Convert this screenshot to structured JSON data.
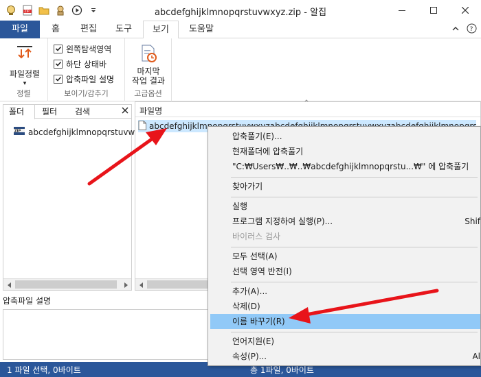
{
  "window": {
    "title": "abcdefghijklmnopqrstuvwxyz.zip - 알집"
  },
  "tabs": [
    {
      "label": "파일"
    },
    {
      "label": "홈"
    },
    {
      "label": "편집"
    },
    {
      "label": "도구"
    },
    {
      "label": "보기"
    },
    {
      "label": "도움말"
    }
  ],
  "ribbon": {
    "sort_label": "파일정렬",
    "sort_group": "정렬",
    "checks": [
      {
        "label": "왼쪽탐색영역",
        "checked": true
      },
      {
        "label": "하단 상태바",
        "checked": true
      },
      {
        "label": "압축파일 설명",
        "checked": true
      }
    ],
    "view_group": "보이기/감추기",
    "last_result_line1": "마지막",
    "last_result_line2": "작업 결과",
    "advanced_group": "고급옵션"
  },
  "left_pane": {
    "tabs": [
      "폴더",
      "필터",
      "검색"
    ],
    "tree_item": "abcdefghijklmnopqrstuvw"
  },
  "file_list": {
    "column": "파일명",
    "file_name": "abcdefghijklmnopqrstuvwxyzabcdefghijklmnopqrstuvwxyzabcdefghijklmnopqrstuvwxy"
  },
  "comment": {
    "label": "압축파일 설명"
  },
  "status": {
    "left": "1 파일 선택,  0바이트",
    "right": "총 1파일,  0바이트"
  },
  "context_menu": {
    "items": [
      {
        "label": "압축풀기(E)...",
        "shortcut": ""
      },
      {
        "label": "현재폴더에 압축풀기",
        "shortcut": ""
      },
      {
        "label": "\"C:₩Users₩..₩..₩abcdefghijklmnopqrstu...₩\" 에 압축풀기",
        "shortcut": ""
      },
      {
        "label": "찾아가기",
        "shortcut": ""
      },
      {
        "label": "실행",
        "shortcut": ""
      },
      {
        "label": "프로그램 지정하여 실행(P)...",
        "shortcut": "Shif"
      },
      {
        "label": "바이러스 검사",
        "shortcut": ""
      },
      {
        "label": "모두 선택(A)",
        "shortcut": ""
      },
      {
        "label": "선택 영역 반전(I)",
        "shortcut": ""
      },
      {
        "label": "추가(A)...",
        "shortcut": ""
      },
      {
        "label": "삭제(D)",
        "shortcut": ""
      },
      {
        "label": "이름 바꾸기(R)",
        "shortcut": ""
      },
      {
        "label": "언어지원(E)",
        "shortcut": ""
      },
      {
        "label": "속성(P)...",
        "shortcut": "Al"
      }
    ]
  },
  "colors": {
    "accent": "#2b579a",
    "selection": "#cce8ff",
    "menu_highlight": "#91c9f7",
    "arrow": "#e8141a"
  }
}
